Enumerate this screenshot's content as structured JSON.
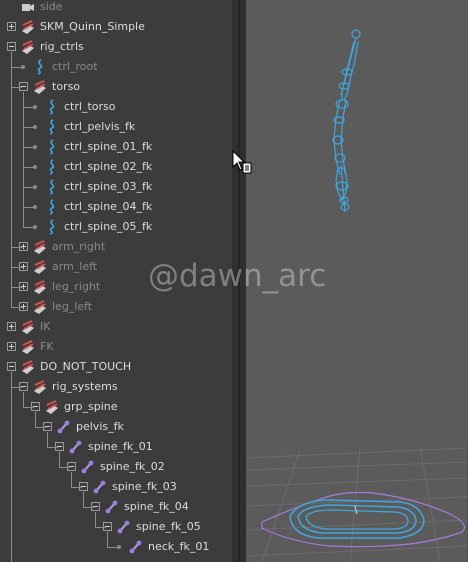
{
  "outliner": {
    "items": [
      {
        "label": "side",
        "icon": "camera-icon"
      },
      {
        "label": "SKM_Quinn_Simple",
        "icon": "transform-group-icon"
      },
      {
        "label": "rig_ctrls",
        "icon": "transform-group-icon"
      },
      {
        "label": "ctrl_root",
        "icon": "nurbs-curve-icon"
      },
      {
        "label": "torso",
        "icon": "transform-group-icon"
      },
      {
        "label": "ctrl_torso",
        "icon": "nurbs-curve-icon"
      },
      {
        "label": "ctrl_pelvis_fk",
        "icon": "nurbs-curve-icon"
      },
      {
        "label": "ctrl_spine_01_fk",
        "icon": "nurbs-curve-icon"
      },
      {
        "label": "ctrl_spine_02_fk",
        "icon": "nurbs-curve-icon"
      },
      {
        "label": "ctrl_spine_03_fk",
        "icon": "nurbs-curve-icon"
      },
      {
        "label": "ctrl_spine_04_fk",
        "icon": "nurbs-curve-icon"
      },
      {
        "label": "ctrl_spine_05_fk",
        "icon": "nurbs-curve-icon"
      },
      {
        "label": "arm_right",
        "icon": "transform-group-icon"
      },
      {
        "label": "arm_left",
        "icon": "transform-group-icon"
      },
      {
        "label": "leg_right",
        "icon": "transform-group-icon"
      },
      {
        "label": "leg_left",
        "icon": "transform-group-icon"
      },
      {
        "label": "IK",
        "icon": "transform-group-icon"
      },
      {
        "label": "FK",
        "icon": "transform-group-icon"
      },
      {
        "label": "DO_NOT_TOUCH",
        "icon": "transform-group-icon"
      },
      {
        "label": "rig_systems",
        "icon": "transform-group-icon"
      },
      {
        "label": "grp_spine",
        "icon": "transform-group-icon"
      },
      {
        "label": "pelvis_fk",
        "icon": "joint-icon"
      },
      {
        "label": "spine_fk_01",
        "icon": "joint-icon"
      },
      {
        "label": "spine_fk_02",
        "icon": "joint-icon"
      },
      {
        "label": "spine_fk_03",
        "icon": "joint-icon"
      },
      {
        "label": "spine_fk_04",
        "icon": "joint-icon"
      },
      {
        "label": "spine_fk_05",
        "icon": "joint-icon"
      },
      {
        "label": "neck_fk_01",
        "icon": "joint-icon"
      }
    ]
  },
  "watermark": "@dawn_arc",
  "colors": {
    "outliner_bg": "#3c3c3c",
    "viewport_bg": "#5b5b5b",
    "text": "#dcdcdc",
    "text_dim": "#8a8a8a",
    "curve": "#3fa7e0",
    "joint": "#9b7fe0",
    "group_icon": "#d9534f"
  }
}
